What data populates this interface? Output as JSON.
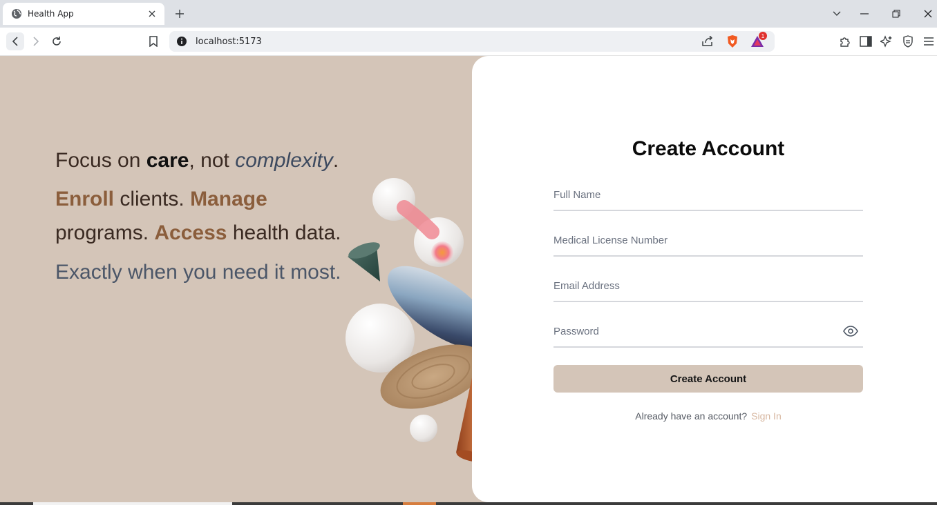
{
  "browser": {
    "tab_title": "Health App",
    "url": "localhost:5173",
    "notification_count": "1"
  },
  "hero": {
    "line1": {
      "a": "Focus on ",
      "b": "care",
      "c": ", not ",
      "d": "complexity",
      "e": "."
    },
    "line2": {
      "a": "Enroll",
      "b": " clients. ",
      "c": "Manage",
      "d": "programs. ",
      "e": "Access",
      "f": " health data."
    },
    "line3": "Exactly when you need it most."
  },
  "form": {
    "title": "Create Account",
    "full_name_placeholder": "Full Name",
    "license_placeholder": "Medical License Number",
    "email_placeholder": "Email Address",
    "password_placeholder": "Password",
    "submit_label": "Create Account",
    "signin_prompt": "Already have an account?",
    "signin_link": "Sign In"
  },
  "colors": {
    "page_background": "#d4c5b8",
    "accent_brown": "#8b5e3c",
    "button_background": "#d4c5b8",
    "link_color": "#d7b7a0"
  },
  "icons": [
    "globe-icon",
    "close-icon",
    "plus-icon",
    "chevron-down-icon",
    "minimize-icon",
    "restore-icon",
    "back-icon",
    "forward-icon",
    "reload-icon",
    "bookmark-icon",
    "info-icon",
    "share-icon",
    "brave-shield-icon",
    "brave-rewards-icon",
    "extensions-icon",
    "sidebar-icon",
    "leo-icon",
    "vpn-icon",
    "menu-icon",
    "eye-icon"
  ]
}
